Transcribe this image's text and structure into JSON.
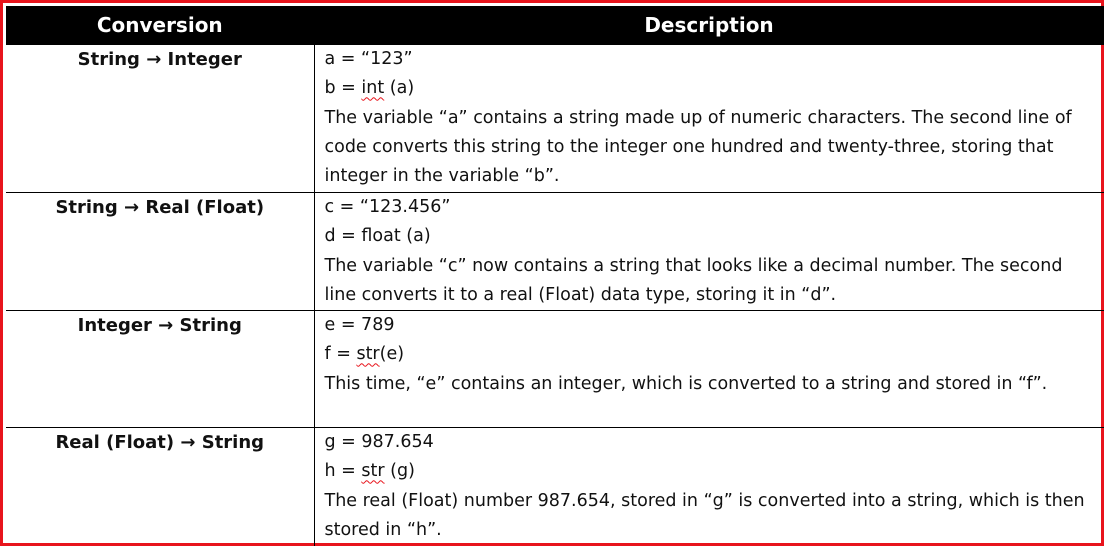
{
  "table": {
    "headers": {
      "conversion": "Conversion",
      "description": "Description"
    },
    "rows": [
      {
        "conversion": "String → Integer",
        "code1": {
          "pre": "a = “123”",
          "kw": "",
          "post": ""
        },
        "code2": {
          "pre": "b = ",
          "kw": "int",
          "post": " (a)"
        },
        "text": "The variable “a” contains a string made up of numeric characters. The second line of code converts this string to the integer one hundred and twenty-three, storing that integer in the variable “b”."
      },
      {
        "conversion": "String → Real (Float)",
        "code1": {
          "pre": "c = “123.456”",
          "kw": "",
          "post": ""
        },
        "code2": {
          "pre": "d = float (a)",
          "kw": "",
          "post": ""
        },
        "text": "The variable “c” now contains a string that looks like a decimal number. The second line converts it to a real (Float) data type, storing it in “d”."
      },
      {
        "conversion": "Integer → String",
        "code1": {
          "pre": "e = 789",
          "kw": "",
          "post": ""
        },
        "code2": {
          "pre": "f = ",
          "kw": "str",
          "post": "(e)"
        },
        "text": "This time, “e” contains an integer, which is converted to a string and stored in “f”."
      },
      {
        "conversion": "Real (Float) → String",
        "code1": {
          "pre": "g = 987.654",
          "kw": "",
          "post": ""
        },
        "code2": {
          "pre": "h = ",
          "kw": "str",
          "post": " (g)"
        },
        "text": "The real (Float) number 987.654, stored in “g” is converted into a string, which is then stored in “h”."
      }
    ]
  },
  "colors": {
    "frame": "#e8141c",
    "header_bg": "#000000",
    "header_text": "#ffffff",
    "spellcheck": "#e8141c"
  }
}
